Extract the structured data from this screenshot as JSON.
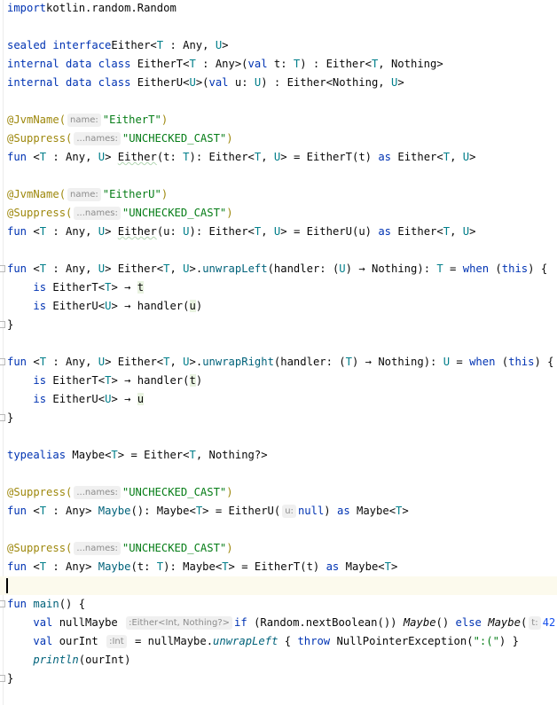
{
  "colors": {
    "keyword": "#0033b3",
    "annotation": "#9e880d",
    "string": "#067d17",
    "number": "#1750eb",
    "type_param": "#007e8a",
    "function_decl": "#00627a",
    "hint_text": "#8c8c8c",
    "current_line_bg": "#fcfaed"
  },
  "lines": [
    {
      "s": [
        [
          "kw",
          "import"
        ],
        [
          "",
          "kotlin.random.Random"
        ]
      ]
    },
    {
      "s": []
    },
    {
      "s": [
        [
          "kw",
          "sealed interface"
        ],
        [
          "",
          "Either<"
        ],
        [
          "tp",
          "T"
        ],
        [
          "",
          " : Any, "
        ],
        [
          "tp",
          "U"
        ],
        [
          "",
          ">"
        ]
      ]
    },
    {
      "s": [
        [
          "kw",
          "internal data class"
        ],
        [
          "",
          " EitherT<"
        ],
        [
          "tp",
          "T"
        ],
        [
          "",
          " : Any>("
        ],
        [
          "kw",
          "val"
        ],
        [
          "",
          " t: "
        ],
        [
          "tp",
          "T"
        ],
        [
          "",
          ") : Either<"
        ],
        [
          "tp",
          "T"
        ],
        [
          "",
          ", Nothing>"
        ]
      ]
    },
    {
      "s": [
        [
          "kw",
          "internal data class"
        ],
        [
          "",
          " EitherU<"
        ],
        [
          "tp",
          "U"
        ],
        [
          "",
          ">("
        ],
        [
          "kw",
          "val"
        ],
        [
          "",
          " u: "
        ],
        [
          "tp",
          "U"
        ],
        [
          "",
          ") : Either<Nothing, "
        ],
        [
          "tp",
          "U"
        ],
        [
          "",
          ">"
        ]
      ]
    },
    {
      "s": []
    },
    {
      "s": [
        [
          "ann",
          "@JvmName("
        ],
        [
          "hint",
          "name:"
        ],
        [
          "str",
          "\"EitherT\""
        ],
        [
          "ann",
          ")"
        ]
      ]
    },
    {
      "s": [
        [
          "ann",
          "@Suppress("
        ],
        [
          "hint",
          "...names:"
        ],
        [
          "str",
          "\"UNCHECKED_CAST\""
        ],
        [
          "ann",
          ")"
        ]
      ]
    },
    {
      "s": [
        [
          "kw",
          "fun"
        ],
        [
          "",
          " <"
        ],
        [
          "tp",
          "T"
        ],
        [
          "",
          " : Any, "
        ],
        [
          "tp",
          "U"
        ],
        [
          "",
          "> "
        ],
        [
          "typo",
          "Either"
        ],
        [
          "",
          "(t: "
        ],
        [
          "tp",
          "T"
        ],
        [
          "",
          "): Either<"
        ],
        [
          "tp",
          "T"
        ],
        [
          "",
          ", "
        ],
        [
          "tp",
          "U"
        ],
        [
          "",
          "> = EitherT(t) "
        ],
        [
          "kw",
          "as"
        ],
        [
          "",
          " Either<"
        ],
        [
          "tp",
          "T"
        ],
        [
          "",
          ", "
        ],
        [
          "tp",
          "U"
        ],
        [
          "",
          ">"
        ]
      ]
    },
    {
      "s": []
    },
    {
      "s": [
        [
          "ann",
          "@JvmName("
        ],
        [
          "hint",
          "name:"
        ],
        [
          "str",
          "\"EitherU\""
        ],
        [
          "ann",
          ")"
        ]
      ]
    },
    {
      "s": [
        [
          "ann",
          "@Suppress("
        ],
        [
          "hint",
          "...names:"
        ],
        [
          "str",
          "\"UNCHECKED_CAST\""
        ],
        [
          "ann",
          ")"
        ]
      ]
    },
    {
      "s": [
        [
          "kw",
          "fun"
        ],
        [
          "",
          " <"
        ],
        [
          "tp",
          "T"
        ],
        [
          "",
          " : Any, "
        ],
        [
          "tp",
          "U"
        ],
        [
          "",
          "> "
        ],
        [
          "typo",
          "Either"
        ],
        [
          "",
          "(u: "
        ],
        [
          "tp",
          "U"
        ],
        [
          "",
          "): Either<"
        ],
        [
          "tp",
          "T"
        ],
        [
          "",
          ", "
        ],
        [
          "tp",
          "U"
        ],
        [
          "",
          "> = EitherU(u) "
        ],
        [
          "kw",
          "as"
        ],
        [
          "",
          " Either<"
        ],
        [
          "tp",
          "T"
        ],
        [
          "",
          ", "
        ],
        [
          "tp",
          "U"
        ],
        [
          "",
          ">"
        ]
      ]
    },
    {
      "s": []
    },
    {
      "s": [
        [
          "kw",
          "fun"
        ],
        [
          "",
          " <"
        ],
        [
          "tp",
          "T"
        ],
        [
          "",
          " : Any, "
        ],
        [
          "tp",
          "U"
        ],
        [
          "",
          "> Either<"
        ],
        [
          "tp",
          "T"
        ],
        [
          "",
          ", "
        ],
        [
          "tp",
          "U"
        ],
        [
          "",
          ">."
        ],
        [
          "fn",
          "unwrapLeft"
        ],
        [
          "",
          "(handler: ("
        ],
        [
          "tp",
          "U"
        ],
        [
          "",
          ") → Nothing): "
        ],
        [
          "tp",
          "T"
        ],
        [
          "",
          " = "
        ],
        [
          "kw",
          "when"
        ],
        [
          "",
          " ("
        ],
        [
          "kw",
          "this"
        ],
        [
          "",
          ") {"
        ]
      ]
    },
    {
      "s": [
        [
          "",
          "    "
        ],
        [
          "kw",
          "is"
        ],
        [
          "",
          " EitherT<"
        ],
        [
          "tp",
          "T"
        ],
        [
          "",
          "> → "
        ],
        [
          "hl",
          "t"
        ]
      ]
    },
    {
      "s": [
        [
          "",
          "    "
        ],
        [
          "kw",
          "is"
        ],
        [
          "",
          " EitherU<"
        ],
        [
          "tp",
          "U"
        ],
        [
          "",
          "> → handler("
        ],
        [
          "hl",
          "u"
        ],
        [
          "",
          ")"
        ]
      ]
    },
    {
      "s": [
        [
          "",
          "}"
        ]
      ]
    },
    {
      "s": []
    },
    {
      "s": [
        [
          "kw",
          "fun"
        ],
        [
          "",
          " <"
        ],
        [
          "tp",
          "T"
        ],
        [
          "",
          " : Any, "
        ],
        [
          "tp",
          "U"
        ],
        [
          "",
          "> Either<"
        ],
        [
          "tp",
          "T"
        ],
        [
          "",
          ", "
        ],
        [
          "tp",
          "U"
        ],
        [
          "",
          ">."
        ],
        [
          "fn",
          "unwrapRight"
        ],
        [
          "",
          "(handler: ("
        ],
        [
          "tp",
          "T"
        ],
        [
          "",
          ") → Nothing): "
        ],
        [
          "tp",
          "U"
        ],
        [
          "",
          " = "
        ],
        [
          "kw",
          "when"
        ],
        [
          "",
          " ("
        ],
        [
          "kw",
          "this"
        ],
        [
          "",
          ") {"
        ]
      ]
    },
    {
      "s": [
        [
          "",
          "    "
        ],
        [
          "kw",
          "is"
        ],
        [
          "",
          " EitherT<"
        ],
        [
          "tp",
          "T"
        ],
        [
          "",
          "> → handler("
        ],
        [
          "hl",
          "t"
        ],
        [
          "",
          ")"
        ]
      ]
    },
    {
      "s": [
        [
          "",
          "    "
        ],
        [
          "kw",
          "is"
        ],
        [
          "",
          " EitherU<"
        ],
        [
          "tp",
          "U"
        ],
        [
          "",
          "> → "
        ],
        [
          "hl",
          "u"
        ]
      ]
    },
    {
      "s": [
        [
          "",
          "}"
        ]
      ]
    },
    {
      "s": []
    },
    {
      "s": [
        [
          "kw",
          "typealias"
        ],
        [
          "",
          " Maybe<"
        ],
        [
          "tp",
          "T"
        ],
        [
          "",
          "> = Either<"
        ],
        [
          "tp",
          "T"
        ],
        [
          "",
          ", Nothing?>"
        ]
      ]
    },
    {
      "s": []
    },
    {
      "s": [
        [
          "ann",
          "@Suppress("
        ],
        [
          "hint",
          "...names:"
        ],
        [
          "str",
          "\"UNCHECKED_CAST\""
        ],
        [
          "ann",
          ")"
        ]
      ]
    },
    {
      "s": [
        [
          "kw",
          "fun"
        ],
        [
          "",
          " <"
        ],
        [
          "tp",
          "T"
        ],
        [
          "",
          " : Any> "
        ],
        [
          "fn",
          "Maybe"
        ],
        [
          "",
          "(): Maybe<"
        ],
        [
          "tp",
          "T"
        ],
        [
          "",
          "> = EitherU("
        ],
        [
          "hint",
          "u:"
        ],
        [
          "kw",
          "null"
        ],
        [
          "",
          ") "
        ],
        [
          "kw",
          "as"
        ],
        [
          "",
          " Maybe<"
        ],
        [
          "tp",
          "T"
        ],
        [
          "",
          ">"
        ]
      ]
    },
    {
      "s": []
    },
    {
      "s": [
        [
          "ann",
          "@Suppress("
        ],
        [
          "hint",
          "...names:"
        ],
        [
          "str",
          "\"UNCHECKED_CAST\""
        ],
        [
          "ann",
          ")"
        ]
      ]
    },
    {
      "s": [
        [
          "kw",
          "fun"
        ],
        [
          "",
          " <"
        ],
        [
          "tp",
          "T"
        ],
        [
          "",
          " : Any> "
        ],
        [
          "fn",
          "Maybe"
        ],
        [
          "",
          "(t: "
        ],
        [
          "tp",
          "T"
        ],
        [
          "",
          "): Maybe<"
        ],
        [
          "tp",
          "T"
        ],
        [
          "",
          "> = EitherT(t) "
        ],
        [
          "kw",
          "as"
        ],
        [
          "",
          " Maybe<"
        ],
        [
          "tp",
          "T"
        ],
        [
          "",
          ">"
        ]
      ]
    },
    {
      "s": [],
      "current": true
    },
    {
      "s": [
        [
          "kw",
          "fun"
        ],
        [
          "",
          " "
        ],
        [
          "fn",
          "main"
        ],
        [
          "",
          "() {"
        ]
      ]
    },
    {
      "s": [
        [
          "",
          "    "
        ],
        [
          "kw",
          "val"
        ],
        [
          "",
          " nullMaybe "
        ],
        [
          "hint",
          ":Either<Int, Nothing?>"
        ],
        [
          "",
          "",
          " = "
        ],
        [
          "kw",
          "if"
        ],
        [
          "",
          " (Random.nextBoolean()) "
        ],
        [
          "it",
          "Maybe"
        ],
        [
          "",
          "() "
        ],
        [
          "kw",
          "else"
        ],
        [
          "",
          " "
        ],
        [
          "it",
          "Maybe"
        ],
        [
          "",
          "("
        ],
        [
          "hint",
          "t:"
        ],
        [
          "num",
          "42"
        ],
        [
          "",
          ")"
        ]
      ]
    },
    {
      "s": [
        [
          "",
          "    "
        ],
        [
          "kw",
          "val"
        ],
        [
          "",
          " ourInt "
        ],
        [
          "hint",
          ":Int"
        ],
        [
          "",
          " = nullMaybe."
        ],
        [
          "fnit",
          "unwrapLeft"
        ],
        [
          "",
          " { "
        ],
        [
          "kw",
          "throw"
        ],
        [
          "",
          " NullPointerException("
        ],
        [
          "str",
          "\":(\""
        ],
        [
          "",
          ") }"
        ]
      ]
    },
    {
      "s": [
        [
          "",
          "    "
        ],
        [
          "fnit",
          "println"
        ],
        [
          "",
          "(ourInt)"
        ]
      ]
    },
    {
      "s": [
        [
          "",
          "}"
        ]
      ]
    }
  ]
}
